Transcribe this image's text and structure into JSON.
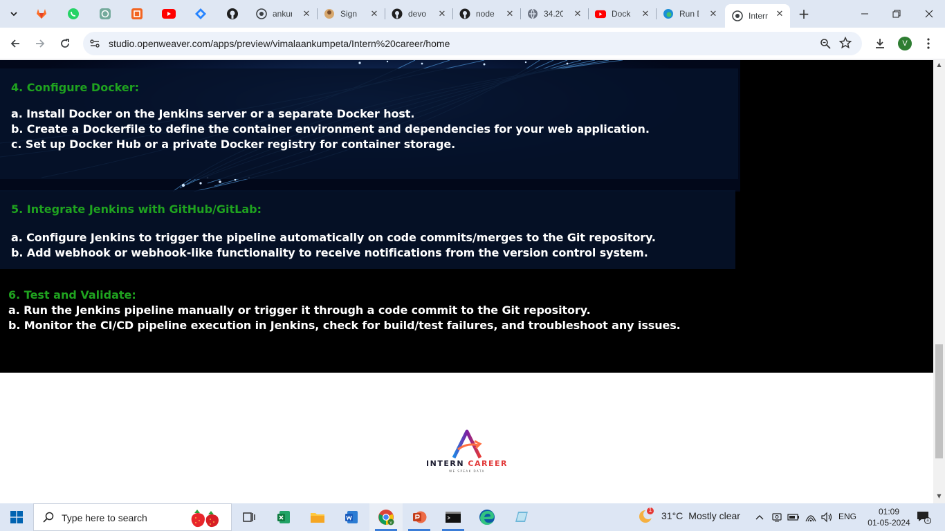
{
  "browser": {
    "tabs": [
      {
        "title": "ankur",
        "icon": "openweaver-icon"
      },
      {
        "title": "Sign",
        "icon": "avatar-icon"
      },
      {
        "title": "devo",
        "icon": "github-icon"
      },
      {
        "title": "node",
        "icon": "github-icon"
      },
      {
        "title": "34.20",
        "icon": "globe-icon"
      },
      {
        "title": "Dock",
        "icon": "youtube-icon"
      },
      {
        "title": "Run D",
        "icon": "edge-icon"
      },
      {
        "title": "Intern",
        "icon": "openweaver-icon",
        "active": true
      }
    ],
    "pinned_icons": [
      "gitlab-icon",
      "whatsapp-icon",
      "chatgpt-icon",
      "grid-app-icon",
      "youtube-icon",
      "jira-icon",
      "github-icon"
    ],
    "url": "studio.openweaver.com/apps/preview/vimalaankumpeta/Intern%20career/home",
    "profile_initial": "V"
  },
  "content": {
    "sections": [
      {
        "heading": "4. Configure Docker:",
        "items": [
          "a. Install Docker on the Jenkins server or a separate Docker host.",
          "b. Create a Dockerfile to define the container environment and dependencies for your web application.",
          "c. Set up Docker Hub or a private Docker registry for container storage."
        ]
      },
      {
        "heading": "5. Integrate Jenkins with GitHub/GitLab:",
        "items": [
          "a. Configure Jenkins to trigger the pipeline automatically on code commits/merges to the Git repository.",
          "b. Add webhook or webhook-like functionality to receive notifications from the version control system."
        ]
      },
      {
        "heading": "6. Test and Validate:",
        "items": [
          "a. Run the Jenkins pipeline manually or trigger it through a code commit to the Git repository.",
          "b. Monitor the CI/CD pipeline execution in Jenkins, check for build/test failures, and troubleshoot any issues."
        ]
      }
    ],
    "footer_logo": {
      "word1": "INTERN",
      "word2": "CAREER",
      "tagline": "WE SPEAK DATA"
    }
  },
  "taskbar": {
    "search_placeholder": "Type here to search",
    "weather_temp": "31°C",
    "weather_text": "Mostly clear",
    "weather_badge": "1",
    "language": "ENG",
    "time": "01:09",
    "date": "01-05-2024",
    "notification_count": "1"
  },
  "colors": {
    "heading_green": "#1fa31f",
    "panel_navy": "#06122a",
    "tabstrip": "#dfe7f3",
    "taskbar": "#dde6f4"
  }
}
